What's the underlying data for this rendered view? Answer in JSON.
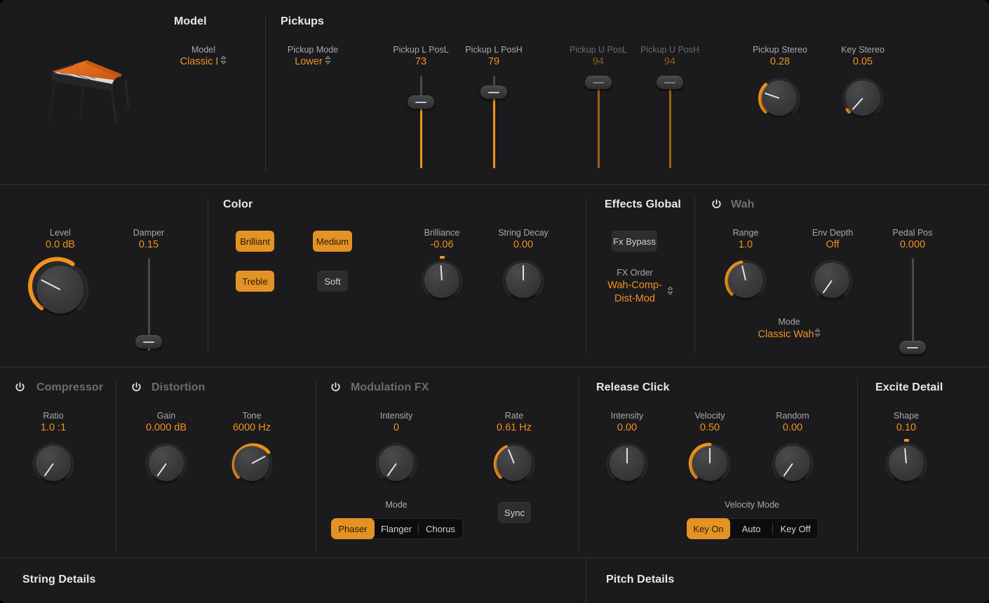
{
  "sections": {
    "model": {
      "title": "Model"
    },
    "pickups": {
      "title": "Pickups"
    },
    "color": {
      "title": "Color"
    },
    "effects_global": {
      "title": "Effects Global"
    },
    "wah": {
      "title": "Wah",
      "power_icon": "power-icon",
      "enabled": false
    },
    "compressor": {
      "title": "Compressor",
      "power_icon": "power-icon",
      "enabled": false
    },
    "distortion": {
      "title": "Distortion",
      "power_icon": "power-icon",
      "enabled": false
    },
    "modulation_fx": {
      "title": "Modulation FX",
      "power_icon": "power-icon",
      "enabled": false
    },
    "release_click": {
      "title": "Release Click"
    },
    "excite_detail": {
      "title": "Excite Detail"
    },
    "string_details": {
      "title": "String Details"
    },
    "pitch_details": {
      "title": "Pitch Details"
    }
  },
  "model": {
    "label": "Model",
    "value": "Classic I",
    "image": "electric-piano-image"
  },
  "pickups": {
    "mode": {
      "label": "Pickup Mode",
      "value": "Lower"
    },
    "sliders": [
      {
        "label": "Pickup L PosL",
        "value": "73",
        "disabled": false
      },
      {
        "label": "Pickup L PosH",
        "value": "79",
        "disabled": false
      },
      {
        "label": "Pickup U PosL",
        "value": "94",
        "disabled": true
      },
      {
        "label": "Pickup U PosH",
        "value": "94",
        "disabled": true
      }
    ],
    "knobs": [
      {
        "label": "Pickup Stereo",
        "value": "0.28"
      },
      {
        "label": "Key Stereo",
        "value": "0.05"
      }
    ]
  },
  "main": {
    "level": {
      "label": "Level",
      "value": "0.0 dB"
    },
    "damper": {
      "label": "Damper",
      "value": "0.15"
    },
    "color_buttons": [
      {
        "label": "Brilliant",
        "on": true
      },
      {
        "label": "Treble",
        "on": true
      },
      {
        "label": "Medium",
        "on": true
      },
      {
        "label": "Soft",
        "on": false
      }
    ],
    "brilliance": {
      "label": "Brilliance",
      "value": "-0.06"
    },
    "string_decay": {
      "label": "String Decay",
      "value": "0.00"
    }
  },
  "effects_global": {
    "fx_bypass": {
      "label": "Fx Bypass",
      "on": false
    },
    "fx_order": {
      "label": "FX Order",
      "value_line1": "Wah-Comp-",
      "value_line2": "Dist-Mod"
    }
  },
  "wah": {
    "range": {
      "label": "Range",
      "value": "1.0"
    },
    "env_depth": {
      "label": "Env Depth",
      "value": "Off"
    },
    "pedal_pos": {
      "label": "Pedal Pos",
      "value": "0.000"
    },
    "mode": {
      "label": "Mode",
      "value": "Classic Wah"
    }
  },
  "compressor": {
    "ratio": {
      "label": "Ratio",
      "value": "1.0 :1"
    }
  },
  "distortion": {
    "gain": {
      "label": "Gain",
      "value": "0.000 dB"
    },
    "tone": {
      "label": "Tone",
      "value": "6000 Hz"
    }
  },
  "modulation_fx": {
    "intensity": {
      "label": "Intensity",
      "value": "0"
    },
    "rate": {
      "label": "Rate",
      "value": "0.61 Hz"
    },
    "mode_label": "Mode",
    "modes": [
      {
        "label": "Phaser",
        "on": true
      },
      {
        "label": "Flanger",
        "on": false
      },
      {
        "label": "Chorus",
        "on": false
      }
    ],
    "sync": {
      "label": "Sync",
      "on": false
    }
  },
  "release_click": {
    "intensity": {
      "label": "Intensity",
      "value": "0.00"
    },
    "velocity": {
      "label": "Velocity",
      "value": "0.50"
    },
    "random": {
      "label": "Random",
      "value": "0.00"
    },
    "velocity_mode_label": "Velocity Mode",
    "velocity_modes": [
      {
        "label": "Key On",
        "on": true
      },
      {
        "label": "Auto",
        "on": false
      },
      {
        "label": "Key Off",
        "on": false
      }
    ]
  },
  "excite_detail": {
    "shape": {
      "label": "Shape",
      "value": "0.10"
    }
  },
  "colors": {
    "accent": "#f0921e",
    "accent_button": "#e39224",
    "accent_dim": "#8d5c14",
    "background": "#1b1b1d",
    "label": "#a9a9ad",
    "title": "#e8e8ea",
    "title_off": "#6d6d70",
    "divider": "#343437"
  }
}
